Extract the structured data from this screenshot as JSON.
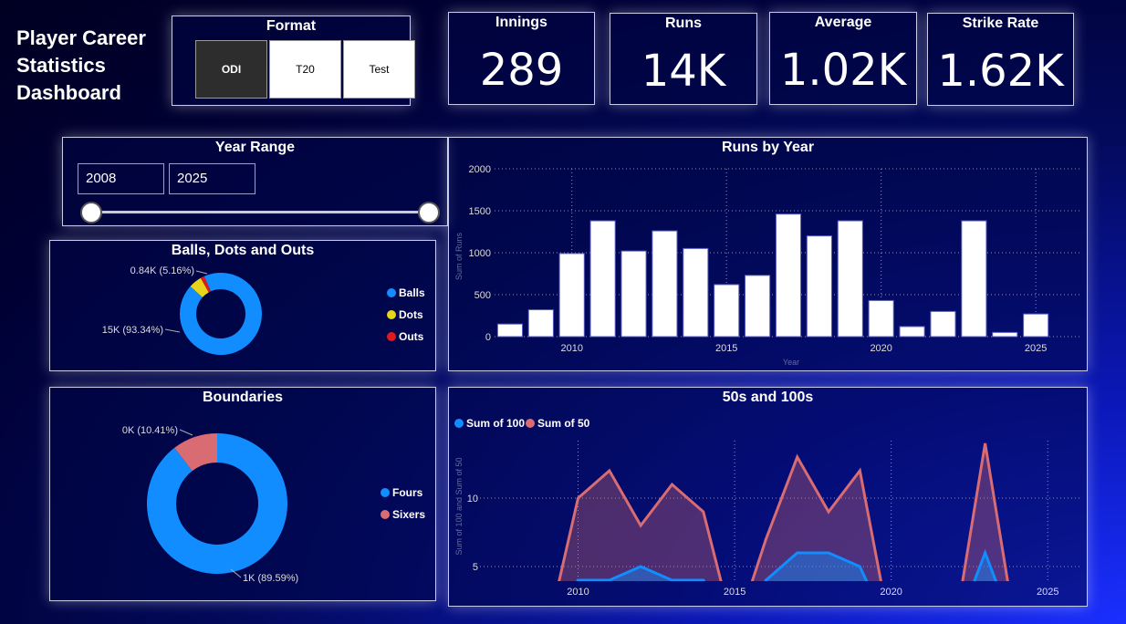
{
  "title": "Player Career Statistics Dashboard",
  "format": {
    "title": "Format",
    "options": [
      "ODI",
      "T20",
      "Test"
    ],
    "selected": "ODI"
  },
  "kpis": {
    "innings": {
      "label": "Innings",
      "value": "289"
    },
    "runs": {
      "label": "Runs",
      "value": "14K"
    },
    "average": {
      "label": "Average",
      "value": "1.02K"
    },
    "strike_rate": {
      "label": "Strike Rate",
      "value": "1.62K"
    }
  },
  "year_range": {
    "title": "Year Range",
    "from": "2008",
    "to": "2025"
  },
  "colors": {
    "bars": "#ffffff",
    "balls": "#118dff",
    "dots": "#e8d41a",
    "outs": "#e01a1a",
    "fours": "#118dff",
    "sixers": "#d86c72",
    "sum100": "#118dff",
    "sum50": "#d86c72"
  },
  "chart_data": [
    {
      "id": "balls-donut",
      "type": "pie",
      "title": "Balls, Dots and Outs",
      "categories": [
        "Balls",
        "Dots",
        "Outs"
      ],
      "values": [
        93.34,
        5.16,
        1.5
      ],
      "data_labels": [
        "15K (93.34%)",
        "0.84K (5.16%)"
      ],
      "legend": "right"
    },
    {
      "id": "runs-by-year",
      "type": "bar",
      "title": "Runs by Year",
      "xlabel": "Year",
      "ylabel": "Sum of Runs",
      "x": [
        2008,
        2009,
        2010,
        2011,
        2012,
        2013,
        2014,
        2015,
        2016,
        2017,
        2018,
        2019,
        2020,
        2021,
        2022,
        2023,
        2024,
        2025
      ],
      "values": [
        150,
        320,
        990,
        1380,
        1020,
        1260,
        1050,
        620,
        730,
        1460,
        1200,
        1380,
        430,
        120,
        300,
        1380,
        50,
        270
      ],
      "ylim": [
        0,
        2000
      ],
      "yticks": [
        "0",
        "500",
        "1000",
        "1500",
        "2000"
      ],
      "xticks": [
        "2010",
        "2015",
        "2020",
        "2025"
      ],
      "grid": true
    },
    {
      "id": "boundaries-donut",
      "type": "pie",
      "title": "Boundaries",
      "categories": [
        "Fours",
        "Sixers"
      ],
      "values": [
        89.59,
        10.41
      ],
      "data_labels": [
        "1K (89.59%)",
        "0K (10.41%)"
      ],
      "legend": "right"
    },
    {
      "id": "fifties-hundreds",
      "type": "area",
      "title": "50s and 100s",
      "ylabel": "Sum of 100 and Sum of 50",
      "x": [
        2008,
        2009,
        2010,
        2011,
        2012,
        2013,
        2014,
        2015,
        2016,
        2017,
        2018,
        2019,
        2020,
        2021,
        2022,
        2023,
        2024,
        2025
      ],
      "series": [
        {
          "name": "Sum of 100",
          "values": [
            null,
            null,
            4,
            4,
            5,
            4,
            4,
            null,
            4,
            6,
            6,
            5,
            null,
            null,
            null,
            6,
            null,
            null
          ]
        },
        {
          "name": "Sum of 50",
          "values": [
            null,
            null,
            10,
            12,
            8,
            11,
            9,
            null,
            7,
            13,
            9,
            12,
            null,
            null,
            null,
            14,
            null,
            null
          ]
        }
      ],
      "yticks": [
        "5",
        "10"
      ],
      "xticks": [
        "2010",
        "2015",
        "2020",
        "2025"
      ],
      "legend": "top-left",
      "grid": true
    }
  ]
}
